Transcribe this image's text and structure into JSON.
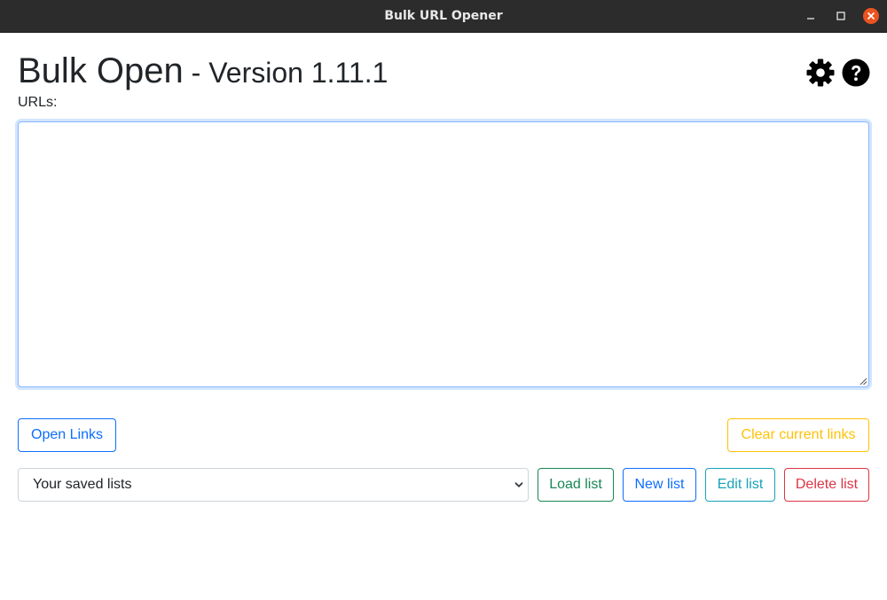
{
  "window": {
    "title": "Bulk URL Opener",
    "close_color": "#e95420"
  },
  "header": {
    "app_name": "Bulk Open",
    "separator": " - ",
    "version": "Version 1.11.1",
    "settings_icon": "gear-icon",
    "help_icon": "question-circle-icon"
  },
  "urls": {
    "label": "URLs:",
    "value": "",
    "placeholder": ""
  },
  "actions": {
    "open_links": "Open Links",
    "clear_links": "Clear current links"
  },
  "saved_lists": {
    "selected": "Your saved lists",
    "load": "Load list",
    "new": "New list",
    "edit": "Edit list",
    "delete": "Delete list"
  },
  "colors": {
    "primary": "#0d6efd",
    "warning": "#ffc107",
    "success": "#198754",
    "info": "#17a2b8",
    "danger": "#dc3545"
  }
}
